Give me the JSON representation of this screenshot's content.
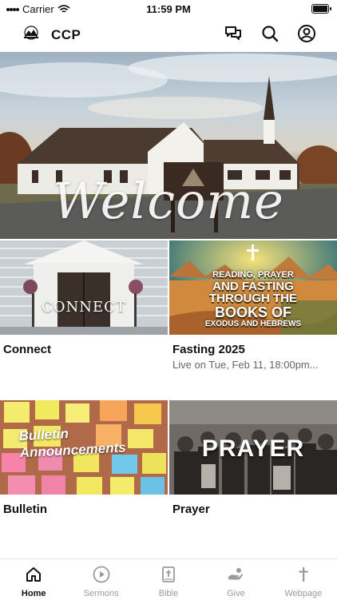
{
  "status_bar": {
    "carrier": "Carrier",
    "time": "11:59 PM"
  },
  "header": {
    "title": "CCP",
    "icons": [
      "chat-icon",
      "search-icon",
      "profile-icon"
    ]
  },
  "hero": {
    "title": "Welcome",
    "slide_count": 4,
    "active_slide": 1
  },
  "cards": [
    {
      "image_label": "CONNECT",
      "title": "Connect",
      "subtitle": ""
    },
    {
      "image_lines": [
        "READING, PRAYER",
        "AND FASTING",
        "THROUGH THE",
        "BOOKS OF",
        "EXODUS AND HEBREWS"
      ],
      "title": "Fasting 2025",
      "subtitle": "Live on Tue, Feb 11, 18:00pm..."
    },
    {
      "image_lines": [
        "Bulletin",
        "Announcements"
      ],
      "title": "Bulletin",
      "subtitle": ""
    },
    {
      "image_label": "PRAYER",
      "title": "Prayer",
      "subtitle": ""
    }
  ],
  "tabs": [
    {
      "label": "Home",
      "icon": "home-icon",
      "active": true
    },
    {
      "label": "Sermons",
      "icon": "play-circle-icon",
      "active": false
    },
    {
      "label": "Bible",
      "icon": "bible-icon",
      "active": false
    },
    {
      "label": "Give",
      "icon": "give-icon",
      "active": false
    },
    {
      "label": "Webpage",
      "icon": "cross-icon",
      "active": false
    }
  ],
  "colors": {
    "accent": "#111111",
    "inactive": "#9a9a9a"
  }
}
